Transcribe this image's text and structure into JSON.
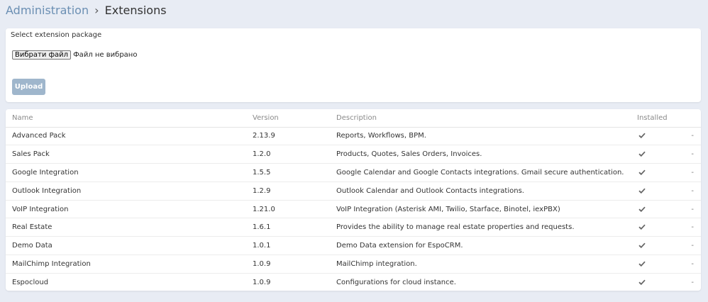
{
  "breadcrumb": {
    "parent": "Administration",
    "separator": "›",
    "current": "Extensions"
  },
  "upload": {
    "label": "Select extension package",
    "file_button": "Вибрати файл",
    "file_status": "Файл не вибрано",
    "upload_button": "Upload"
  },
  "table": {
    "headers": {
      "name": "Name",
      "version": "Version",
      "description": "Description",
      "installed": "Installed"
    },
    "rows": [
      {
        "name": "Advanced Pack",
        "version": "2.13.9",
        "description": "Reports, Workflows, BPM.",
        "installed": true,
        "action": "-"
      },
      {
        "name": "Sales Pack",
        "version": "1.2.0",
        "description": "Products, Quotes, Sales Orders, Invoices.",
        "installed": true,
        "action": "-"
      },
      {
        "name": "Google Integration",
        "version": "1.5.5",
        "description": "Google Calendar and Google Contacts integrations. Gmail secure authentication.",
        "installed": true,
        "action": "-"
      },
      {
        "name": "Outlook Integration",
        "version": "1.2.9",
        "description": "Outlook Calendar and Outlook Contacts integrations.",
        "installed": true,
        "action": "-"
      },
      {
        "name": "VoIP Integration",
        "version": "1.21.0",
        "description": "VoIP Integration (Asterisk AMI, Twilio, Starface, Binotel, iexPBX)",
        "installed": true,
        "action": "-"
      },
      {
        "name": "Real Estate",
        "version": "1.6.1",
        "description": "Provides the ability to manage real estate properties and requests.",
        "installed": true,
        "action": "-"
      },
      {
        "name": "Demo Data",
        "version": "1.0.1",
        "description": "Demo Data extension for EspoCRM.",
        "installed": true,
        "action": "-"
      },
      {
        "name": "MailChimp Integration",
        "version": "1.0.9",
        "description": "MailChimp integration.",
        "installed": true,
        "action": "-"
      },
      {
        "name": "Espocloud",
        "version": "1.0.9",
        "description": "Configurations for cloud instance.",
        "installed": true,
        "action": "-"
      }
    ]
  },
  "icons": {
    "installed": "check-icon"
  },
  "colors": {
    "background": "#e8ecf4",
    "link": "#6b8fb3",
    "upload_button": "#9fb6cc",
    "check": "#666666"
  }
}
